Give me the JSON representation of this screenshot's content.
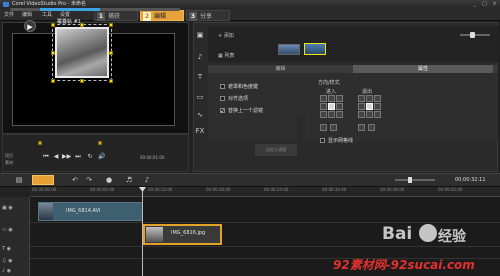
{
  "window": {
    "title": "Corel VideoStudio Pro - 未命名",
    "controls": {
      "minimize": "_",
      "maximize": "□",
      "close": "×"
    }
  },
  "menu": {
    "items": [
      "文件",
      "编辑",
      "工具",
      "设置"
    ]
  },
  "steps": [
    {
      "num": "1",
      "label": "捕获",
      "active": false
    },
    {
      "num": "2",
      "label": "编辑",
      "active": true
    },
    {
      "num": "3",
      "label": "分享",
      "active": false
    }
  ],
  "preview": {
    "caption": "覆叠轨 #1",
    "handle_color": "#f2e21a"
  },
  "playback": {
    "mode_labels": [
      "项目",
      "素材"
    ],
    "play": "▶",
    "buttons": [
      "⏮",
      "◀",
      "▶▶",
      "⏭",
      "↻",
      "🔊"
    ],
    "timecode_small": "00:00:01:00"
  },
  "library": {
    "add_label": "添加",
    "list_label": "列表",
    "side_tools": [
      "▣",
      "♪",
      "T",
      "▭",
      "∿",
      "FX"
    ]
  },
  "options": {
    "tabs": [
      "编辑",
      "属性"
    ],
    "active_tab": 1,
    "checkboxes": [
      {
        "label": "遮罩和色度键",
        "checked": false
      },
      {
        "label": "对齐选项",
        "checked": false
      },
      {
        "label": "替换上一个滤镜",
        "checked": true
      }
    ],
    "motion_title": "方向/样式",
    "enter_label": "进入",
    "exit_label": "退出",
    "distort_label": "显示网格线",
    "custom_filter_label": "自定义滤镜"
  },
  "timeline": {
    "timecode": "00:00:32:11",
    "ruler": [
      "00:00:00:00",
      "00:00:06:00",
      "00:00:12:00",
      "00:00:18:00",
      "00:00:24:00",
      "00:00:30:00",
      "00:00:36:00",
      "00:00:42:00"
    ],
    "clips": [
      {
        "label": "IMG_6814.AVI",
        "track": "video"
      },
      {
        "label": "IMG_6816.jpg",
        "track": "overlay"
      }
    ]
  },
  "watermark": {
    "baidu": "Bai",
    "jingyan": "经验",
    "site": "92素材网-92sucai.com"
  }
}
